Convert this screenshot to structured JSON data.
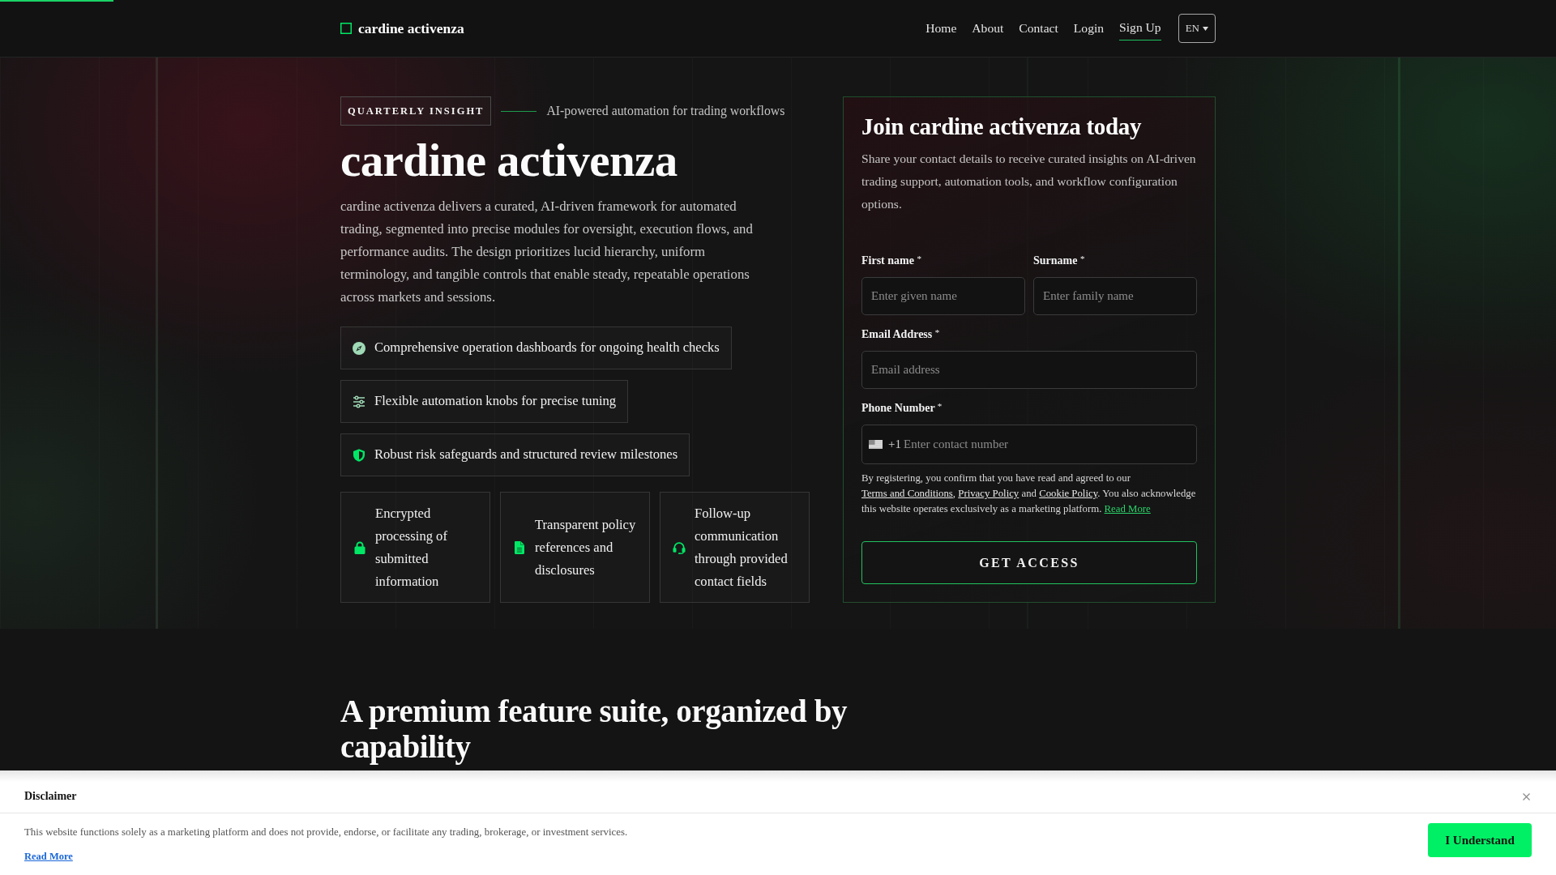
{
  "reading_progress": {
    "level": 0.073
  },
  "header": {
    "logo": "cardine activenza",
    "nav": [
      {
        "label": "Home",
        "kind": "link"
      },
      {
        "label": "About",
        "kind": "link"
      },
      {
        "label": "Contact",
        "kind": "link"
      },
      {
        "label": "Login",
        "kind": "link"
      },
      {
        "label": "Sign Up",
        "kind": "signup"
      }
    ],
    "language": "EN"
  },
  "hero": {
    "badge": "QUARTERLY INSIGHT",
    "tagline": "AI-powered automation for trading workflows",
    "title": "cardine activenza",
    "description": "cardine activenza delivers a curated, AI-driven framework for automated trading, segmented into precise modules for oversight, execution flows, and performance audits. The design prioritizes lucid hierarchy, uniform terminology, and tangible controls that enable steady, repeatable operations across markets and sessions.",
    "highlights": [
      "Comprehensive operation dashboards for ongoing health checks",
      "Flexible automation knobs for precise tuning",
      "Robust risk safeguards and structured review milestones"
    ],
    "info_cards": [
      "Encrypted processing of submitted information",
      "Transparent policy references and disclosures",
      "Follow-up communication through provided contact fields"
    ]
  },
  "signup_form": {
    "title": "Join cardine activenza today",
    "description": "Share your contact details to receive curated insights on AI-driven trading support, automation tools, and workflow configuration options.",
    "rows": [
      [
        {
          "kind": "text",
          "label": "First name $^{*}$",
          "placeholder": "Enter given name"
        },
        {
          "kind": "text",
          "label": "Surname $^{*}$",
          "placeholder": "Enter family name"
        }
      ],
      [
        {
          "kind": "email",
          "label": "Email Address $^{*}$",
          "placeholder": "Email address"
        }
      ],
      [
        {
          "kind": "phone",
          "label": "Phone Number $^{*}$",
          "dial_code": "+1",
          "placeholder": "Enter contact number"
        }
      ]
    ],
    "consent": [
      {
        "kind": "text",
        "text": "By registering, you confirm that you have read and agreed to our "
      },
      {
        "kind": "link",
        "text": "Terms and Conditions"
      },
      {
        "kind": "text",
        "text": ", "
      },
      {
        "kind": "link",
        "text": "Privacy Policy"
      },
      {
        "kind": "text",
        "text": " and "
      },
      {
        "kind": "link",
        "text": "Cookie Policy"
      },
      {
        "kind": "text",
        "text": ". You also acknowledge this website operates exclusively as a marketing platform. "
      },
      {
        "kind": "accent_link",
        "text": "Read More"
      }
    ],
    "submit": "GET ACCESS"
  },
  "features": {
    "title": "A premium feature suite, organized by capability"
  },
  "disclaimer": {
    "title": "Disclaimer",
    "text": "This website functions solely as a marketing platform and does not provide, endorse, or facilitate any trading, brokerage, or investment services.",
    "link": "Read More",
    "button": "I Understand"
  }
}
